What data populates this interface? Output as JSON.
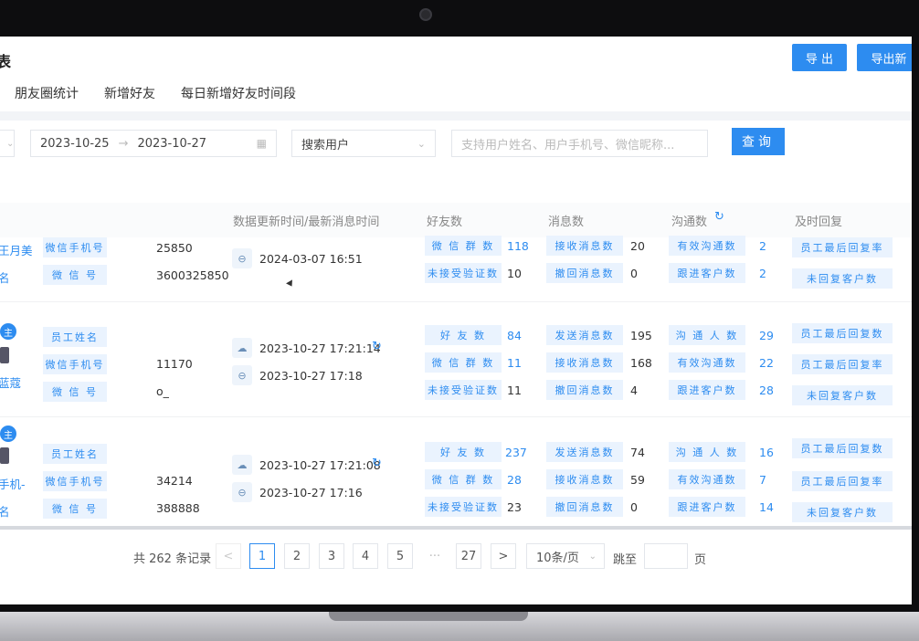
{
  "header": {
    "title": "表",
    "export_label": "导 出",
    "export2_label": "导出新"
  },
  "tabs": [
    "朋友圈统计",
    "新增好友",
    "每日新增好友时间段"
  ],
  "filters": {
    "date_start": "2023-10-25",
    "date_arrow": "→",
    "date_end": "2023-10-27",
    "search_type": "搜索用户",
    "search_placeholder": "支持用户姓名、用户手机号、微信昵称...",
    "query_label": "查询"
  },
  "columns": {
    "update_time": "数据更新时间/最新消息时间",
    "friends": "好友数",
    "messages": "消息数",
    "communication": "沟通数",
    "timely_reply": "及时回复"
  },
  "rows": [
    {
      "user_partial": "王月美",
      "user_partial2": "名",
      "tag_phone": "微信手机号",
      "tag_wx": "微 信 号",
      "phone": "25850",
      "wx": "3600325850",
      "time2": "2024-03-07 16:51",
      "f1_label": "微 信 群 数",
      "f1": "118",
      "f2_label": "未接受验证数",
      "f2": "10",
      "m1_label": "接收消息数",
      "m1": "20",
      "m2_label": "撤回消息数",
      "m2": "0",
      "c1_label": "有效沟通数",
      "c1": "2",
      "c2_label": "跟进客户数",
      "c2": "2",
      "r1_label": "员工最后回复率",
      "r2_label": "未回复客户数"
    },
    {
      "badge": "主",
      "user_partial": "蓝蔻",
      "tag_name": "员工姓名",
      "tag_phone": "微信手机号",
      "tag_wx": "微 信 号",
      "phone": "11170",
      "wx": "o_",
      "time1": "2023-10-27 17:21:14",
      "time2": "2023-10-27 17:18",
      "f0_label": "好 友 数",
      "f0": "84",
      "f1_label": "微 信 群 数",
      "f1": "11",
      "f2_label": "未接受验证数",
      "f2": "11",
      "m0_label": "发送消息数",
      "m0": "195",
      "m1_label": "接收消息数",
      "m1": "168",
      "m2_label": "撤回消息数",
      "m2": "4",
      "c0_label": "沟 通 人 数",
      "c0": "29",
      "c1_label": "有效沟通数",
      "c1": "22",
      "c2_label": "跟进客户数",
      "c2": "28",
      "r0_label": "员工最后回复数",
      "r1_label": "员工最后回复率",
      "r2_label": "未回复客户数"
    },
    {
      "badge": "主",
      "user_partial": "手机-",
      "user_partial2": "名",
      "tag_name": "员工姓名",
      "tag_phone": "微信手机号",
      "tag_wx": "微 信 号",
      "phone": "34214",
      "wx": "388888",
      "time1": "2023-10-27 17:21:08",
      "time2": "2023-10-27 17:16",
      "f0_label": "好 友 数",
      "f0": "237",
      "f1_label": "微 信 群 数",
      "f1": "28",
      "f2_label": "未接受验证数",
      "f2": "23",
      "m0_label": "发送消息数",
      "m0": "74",
      "m1_label": "接收消息数",
      "m1": "59",
      "m2_label": "撤回消息数",
      "m2": "0",
      "c0_label": "沟 通 人 数",
      "c0": "16",
      "c1_label": "有效沟通数",
      "c1": "7",
      "c2_label": "跟进客户数",
      "c2": "14",
      "r0_label": "员工最后回复数",
      "r1_label": "员工最后回复率",
      "r2_label": "未回复客户数"
    }
  ],
  "pagination": {
    "total": "共 262 条记录",
    "pages": [
      "1",
      "2",
      "3",
      "4",
      "5",
      "···",
      "27"
    ],
    "page_size": "10条/页",
    "goto": "跳至",
    "page_unit": "页",
    "prev": "<",
    "next": ">"
  }
}
